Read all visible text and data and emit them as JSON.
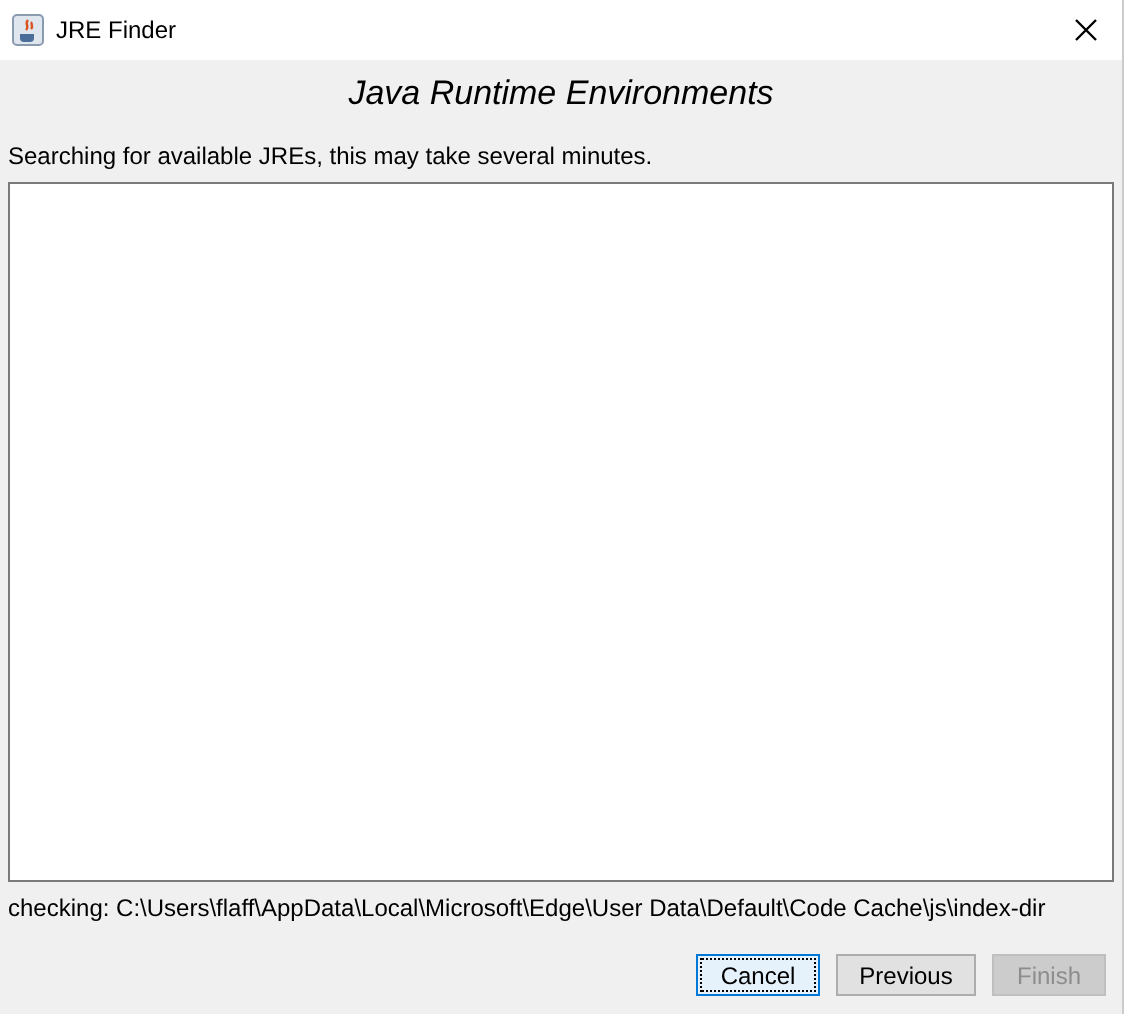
{
  "window": {
    "title": "JRE Finder"
  },
  "heading": "Java Runtime Environments",
  "message": "Searching for available JREs, this may take several minutes.",
  "status": "checking: C:\\Users\\flaff\\AppData\\Local\\Microsoft\\Edge\\User Data\\Default\\Code Cache\\js\\index-dir",
  "buttons": [
    {
      "label": "Cancel",
      "focused": true,
      "disabled": false
    },
    {
      "label": "Previous",
      "focused": false,
      "disabled": false
    },
    {
      "label": "Finish",
      "focused": false,
      "disabled": true
    }
  ]
}
